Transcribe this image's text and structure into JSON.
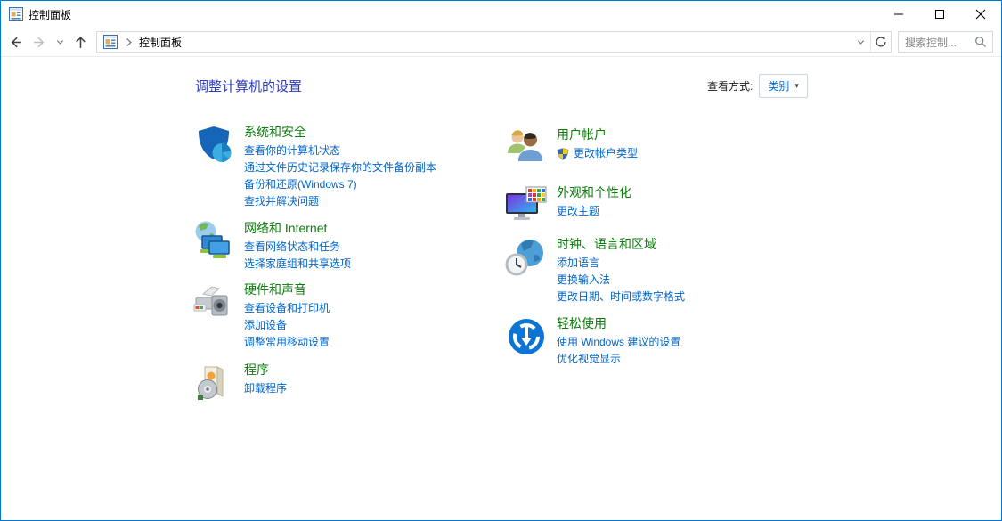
{
  "window": {
    "title": "控制面板"
  },
  "navbar": {
    "breadcrumb_root": "控制面板",
    "search_placeholder": "搜索控制..."
  },
  "header": {
    "title": "调整计算机的设置",
    "view_label": "查看方式:",
    "view_value": "类别"
  },
  "categories": {
    "left": [
      {
        "title": "系统和安全",
        "icon": "shield-pie-icon",
        "links": [
          "查看你的计算机状态",
          "通过文件历史记录保存你的文件备份副本",
          "备份和还原(Windows 7)",
          "查找并解决问题"
        ]
      },
      {
        "title": "网络和 Internet",
        "icon": "globe-monitors-icon",
        "links": [
          "查看网络状态和任务",
          "选择家庭组和共享选项"
        ]
      },
      {
        "title": "硬件和声音",
        "icon": "printer-speaker-icon",
        "links": [
          "查看设备和打印机",
          "添加设备",
          "调整常用移动设置"
        ]
      },
      {
        "title": "程序",
        "icon": "software-box-cd-icon",
        "links": [
          "卸载程序"
        ]
      }
    ],
    "right": [
      {
        "title": "用户帐户",
        "icon": "two-users-icon",
        "links": [
          "更改帐户类型"
        ]
      },
      {
        "title": "外观和个性化",
        "icon": "monitor-palette-icon",
        "links": [
          "更改主题"
        ]
      },
      {
        "title": "时钟、语言和区域",
        "icon": "globe-clock-icon",
        "links": [
          "添加语言",
          "更换输入法",
          "更改日期、时间或数字格式"
        ]
      },
      {
        "title": "轻松使用",
        "icon": "ease-of-access-icon",
        "links": [
          "使用 Windows 建议的设置",
          "优化视觉显示"
        ]
      }
    ]
  },
  "colors": {
    "accent_border": "#0078d7",
    "page_title_blue": "#2b3dbf",
    "category_green": "#0c7d0c",
    "link_blue": "#0066cc"
  }
}
